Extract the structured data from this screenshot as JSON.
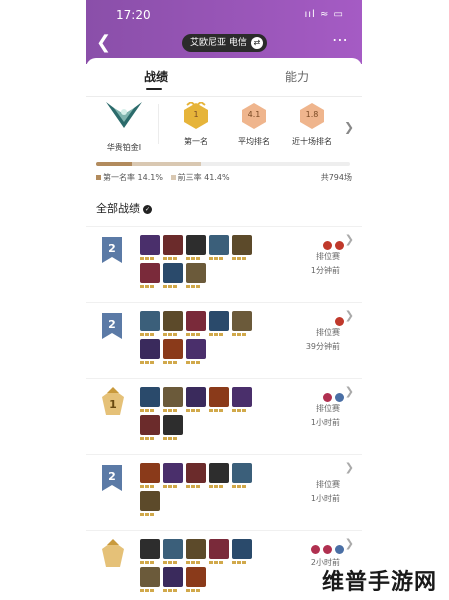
{
  "status": {
    "time": "17:20",
    "icons": "ııl ≈ ▭"
  },
  "header": {
    "back_icon": "chevron-left-icon",
    "server_label": "艾欧尼亚 电信",
    "swap_icon": "swap-icon",
    "more_icon": "more-icon"
  },
  "tabs": [
    {
      "label": "战绩",
      "active": true
    },
    {
      "label": "能力",
      "active": false
    }
  ],
  "summary": {
    "rank_name": "华贵铂金I",
    "stats": [
      {
        "value": "1",
        "label": "第一名"
      },
      {
        "value": "4.1",
        "label": "平均排名"
      },
      {
        "value": "1.8",
        "label": "近十场排名"
      }
    ],
    "first_rate_label": "第一名率 14.1%",
    "top3_rate_label": "前三率 41.4%",
    "total_label": "共794场",
    "first_rate": 0.141,
    "top3_rate": 0.414
  },
  "section_title": "全部战绩",
  "matches": [
    {
      "placement": "2",
      "mode": "排位赛",
      "time": "1分钟前"
    },
    {
      "placement": "2",
      "mode": "排位赛",
      "time": "39分钟前"
    },
    {
      "placement": "1",
      "mode": "排位赛",
      "time": "1小时前"
    },
    {
      "placement": "2",
      "mode": "排位赛",
      "time": "1小时前"
    },
    {
      "placement": "",
      "mode": "",
      "time": "2小时前"
    }
  ],
  "watermark": "维普手游网",
  "colors": {
    "header": "#8a4fa9",
    "gold": "#d1a94b",
    "badge_blue": "#5b7aa6"
  }
}
